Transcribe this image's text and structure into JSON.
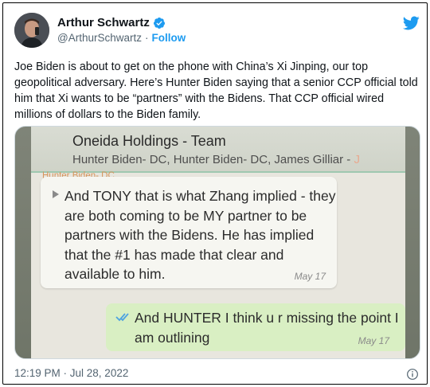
{
  "author": {
    "name": "Arthur Schwartz",
    "handle": "@ArthurSchwartz",
    "separator": "·",
    "follow_label": "Follow"
  },
  "tweet_text": "Joe Biden is about to get on the phone with China’s Xi Jinping, our top geopolitical adversary. Here’s Hunter Biden saying that a senior CCP official told him that Xi wants to be “partners” with the Bidens. That CCP official wired millions of dollars to the Biden family.",
  "photo": {
    "group_name": "Oneida Holdings - Team",
    "members": "Hunter Biden- DC, Hunter Biden- DC, James Gilliar -",
    "members_tail": " J",
    "incoming": {
      "sender": "Hunter Biden- DC",
      "text": "And TONY that is what Zhang implied - they are both coming to be MY partner to be partners with the Bidens. He has implied that the #1 has made that clear and available to him.",
      "time": "May 17"
    },
    "outgoing": {
      "text": "And HUNTER I think u r missing the point I am outlining",
      "time": "May 17"
    }
  },
  "footer": {
    "timestamp": "12:19 PM · Jul 28, 2022"
  },
  "colors": {
    "accent": "#1d9bf0",
    "text": "#0f1419",
    "muted": "#536471"
  },
  "icons": [
    "verified-badge-icon",
    "twitter-bird-icon",
    "info-icon",
    "double-check-icon"
  ]
}
